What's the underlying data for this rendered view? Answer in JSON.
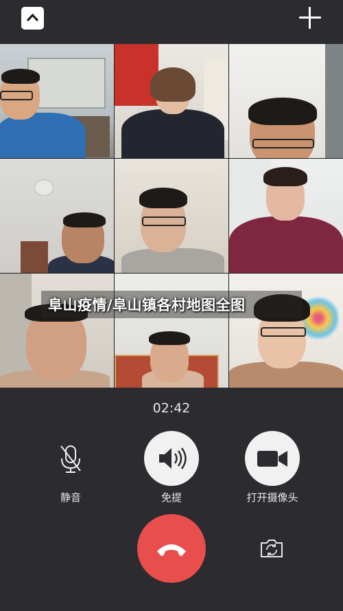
{
  "call": {
    "timer": "02:42",
    "caption": "阜山疫情/阜山镇各村地图全图"
  },
  "controls": {
    "mute_label": "静音",
    "speaker_label": "免提",
    "camera_label": "打开摄像头"
  },
  "colors": {
    "background": "#2b2b30",
    "hangup": "#e84e4b",
    "control_circle": "#f1f1f1"
  },
  "icons": {
    "collapse": "chevron-up-icon",
    "add": "plus-icon",
    "mute": "microphone-off-icon",
    "speaker": "speaker-icon",
    "camera": "video-camera-icon",
    "hangup": "phone-hangup-icon",
    "switch_camera": "switch-camera-icon"
  },
  "participants_count": 9
}
